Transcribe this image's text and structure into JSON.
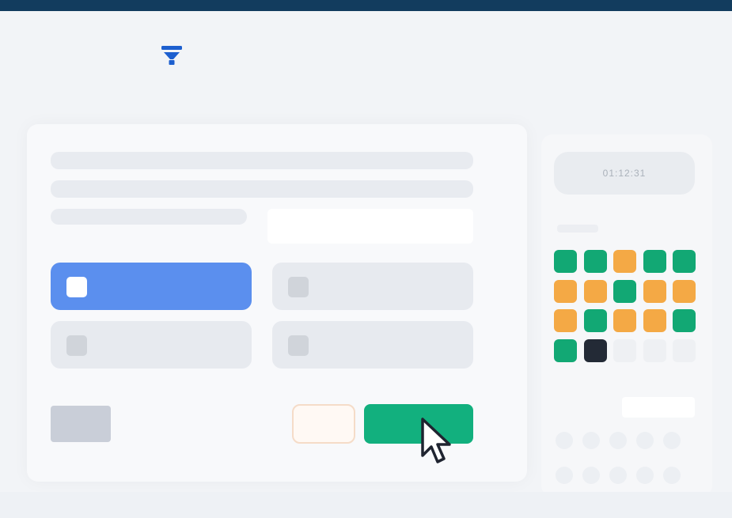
{
  "header": {
    "bar_color": "#123c5e"
  },
  "logo": {
    "icon": "funnel-logo-icon",
    "color": "#1d5fcf"
  },
  "question": {
    "options": [
      {
        "label": "",
        "selected": true
      },
      {
        "label": "",
        "selected": false
      },
      {
        "label": "",
        "selected": false
      },
      {
        "label": "",
        "selected": false
      }
    ]
  },
  "actions": {
    "prev_label": "",
    "skip_label": "",
    "submit_label": "",
    "submit_color": "#12b07e",
    "skip_border_color": "#f5dcc8"
  },
  "timer": {
    "value": "01:12:31"
  },
  "palette": {
    "statuses": [
      "answered",
      "answered",
      "marked",
      "answered",
      "answered",
      "marked",
      "marked",
      "answered",
      "marked",
      "marked",
      "marked",
      "answered",
      "marked",
      "marked",
      "answered",
      "answered",
      "current",
      "unvisited",
      "unvisited",
      "unvisited"
    ],
    "colors": {
      "answered": "#12a874",
      "marked": "#f4a945",
      "current": "#232a36",
      "unvisited": "#eef0f3"
    }
  },
  "cursor": {
    "icon": "mouse-pointer-icon"
  }
}
